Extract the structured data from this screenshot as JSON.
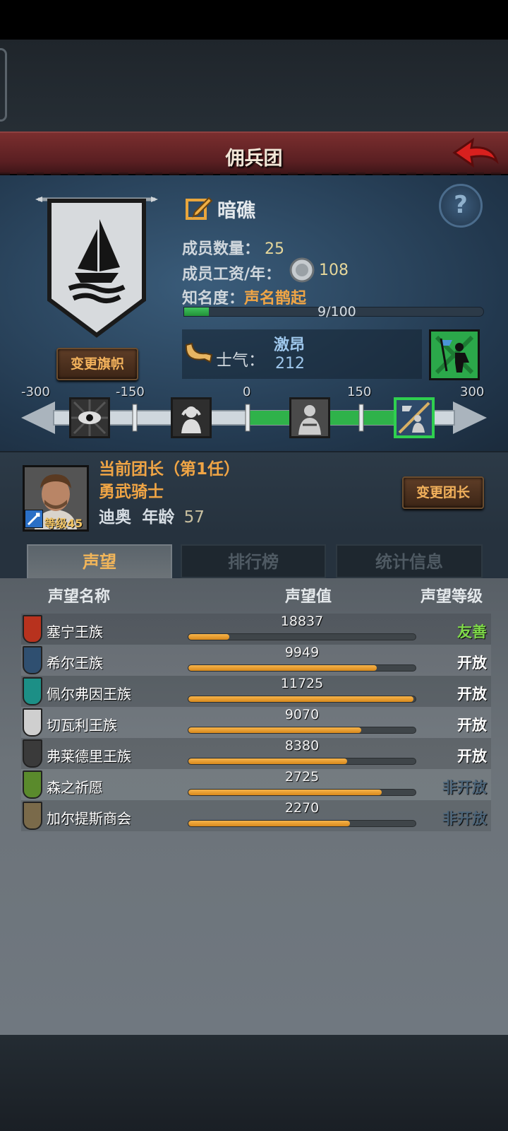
{
  "title": "佣兵团",
  "company": {
    "name": "暗礁",
    "members_label": "成员数量：",
    "members": "25",
    "wage_label": "成员工资/年：",
    "wage": "108",
    "fame_label": "知名度：",
    "fame_rank": "声名鹊起",
    "fame_progress": "9/100",
    "fame_fraction": 0.09,
    "change_banner": "变更旗帜"
  },
  "morale": {
    "label": "士气：",
    "state": "激昂",
    "value": "212",
    "scale_labels": [
      "-300",
      "-150",
      "0",
      "150",
      "300"
    ]
  },
  "leader": {
    "heading": "当前团长（第1任）",
    "title": "勇武骑士",
    "level": "等级45",
    "name": "迪奥",
    "age_label": "年龄",
    "age": "57",
    "change_button": "变更团长"
  },
  "tabs": [
    "声望",
    "排行榜",
    "统计信息"
  ],
  "table": {
    "headers": [
      "声望名称",
      "声望值",
      "声望等级"
    ],
    "rows": [
      {
        "name": "塞宁王族",
        "value": "18837",
        "fill": 0.18,
        "level": "友善",
        "level_color": "#7fd94a",
        "icon_color": "#b8321e"
      },
      {
        "name": "希尔王族",
        "value": "9949",
        "fill": 0.83,
        "level": "开放",
        "level_color": "#ffffff",
        "icon_color": "#2f4f70"
      },
      {
        "name": "佩尔弗因王族",
        "value": "11725",
        "fill": 0.99,
        "level": "开放",
        "level_color": "#ffffff",
        "icon_color": "#1c8f86"
      },
      {
        "name": "切瓦利王族",
        "value": "9070",
        "fill": 0.76,
        "level": "开放",
        "level_color": "#ffffff",
        "icon_color": "#cfcfcf"
      },
      {
        "name": "弗莱德里王族",
        "value": "8380",
        "fill": 0.7,
        "level": "开放",
        "level_color": "#ffffff",
        "icon_color": "#3a3a3a"
      },
      {
        "name": "森之祈愿",
        "value": "2725",
        "fill": 0.85,
        "level": "非开放",
        "level_color": "#4c6478",
        "icon_color": "#5a8a2c"
      },
      {
        "name": "加尔提斯商会",
        "value": "2270",
        "fill": 0.71,
        "level": "非开放",
        "level_color": "#4c6478",
        "icon_color": "#7a6a4a"
      }
    ]
  }
}
